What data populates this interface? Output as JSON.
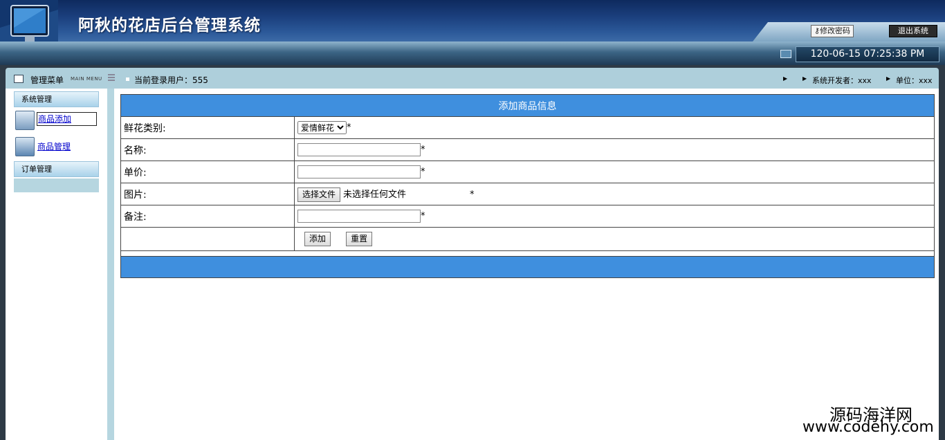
{
  "header": {
    "title": "阿秋的花店后台管理系统",
    "change_password": "修改密码",
    "logout": "退出系统",
    "datetime": "120-06-15 07:25:38 PM"
  },
  "infobar": {
    "menu_title": "管理菜单",
    "menu_sub": "MAIN MENU",
    "current_user": "当前登录用户：555",
    "developer": "系统开发者：xxx",
    "unit": "单位：xxx"
  },
  "sidebar": {
    "section_system": "系统管理",
    "items": [
      {
        "label": "商品添加",
        "icon": "user-settings-icon"
      },
      {
        "label": "商品管理",
        "icon": "gear-icon"
      }
    ],
    "section_order": "订单管理"
  },
  "form": {
    "title": "添加商品信息",
    "category_label": "鲜花类别:",
    "category_value": "爱情鲜花",
    "name_label": "名称:",
    "price_label": "单价:",
    "image_label": "图片:",
    "file_button": "选择文件",
    "file_status": "未选择任何文件",
    "remark_label": "备注:",
    "required": "*",
    "submit": "添加",
    "reset": "重置"
  },
  "watermark": {
    "line1": "源码海洋网",
    "line2": "www.codehy.com"
  },
  "colors": {
    "accent_blue": "#3f8fde",
    "header_dark": "#0e2a5e",
    "sidebar_bg": "#b6d6e0"
  }
}
